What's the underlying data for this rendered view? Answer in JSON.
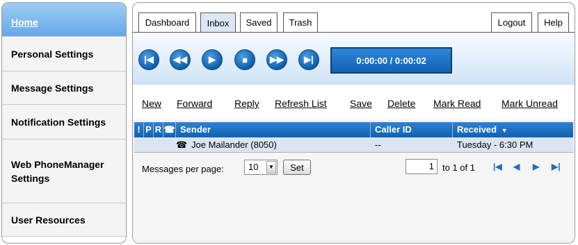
{
  "sidebar": {
    "items": [
      {
        "label": "Home"
      },
      {
        "label": "Personal Settings"
      },
      {
        "label": "Message Settings"
      },
      {
        "label": "Notification Settings"
      },
      {
        "label": "Web PhoneManager Settings"
      },
      {
        "label": "User Resources"
      }
    ]
  },
  "tabs": {
    "dashboard": "Dashboard",
    "inbox": "Inbox",
    "saved": "Saved",
    "trash": "Trash",
    "logout": "Logout",
    "help": "Help"
  },
  "player": {
    "time": "0:00:00 / 0:00:02"
  },
  "actions": {
    "new": "New",
    "forward": "Forward",
    "reply": "Reply",
    "refresh": "Refresh List",
    "save": "Save",
    "delete": "Delete",
    "mark_read": "Mark Read",
    "mark_unread": "Mark Unread"
  },
  "table": {
    "headers": {
      "urgent": "!",
      "private": "P",
      "receipt": "R",
      "sender": "Sender",
      "caller_id": "Caller ID",
      "received": "Received"
    },
    "rows": [
      {
        "sender": "Joe Mailander (8050)",
        "caller_id": "--",
        "received": "Tuesday - 6:30 PM"
      }
    ]
  },
  "pager": {
    "per_page_label": "Messages per page:",
    "per_page_value": "10",
    "set_label": "Set",
    "page_value": "1",
    "of_text": "to 1 of 1"
  },
  "colors": {
    "accent": "#1261b0",
    "row_bg": "#dbe5f1",
    "active_side": "#64a8e8"
  }
}
